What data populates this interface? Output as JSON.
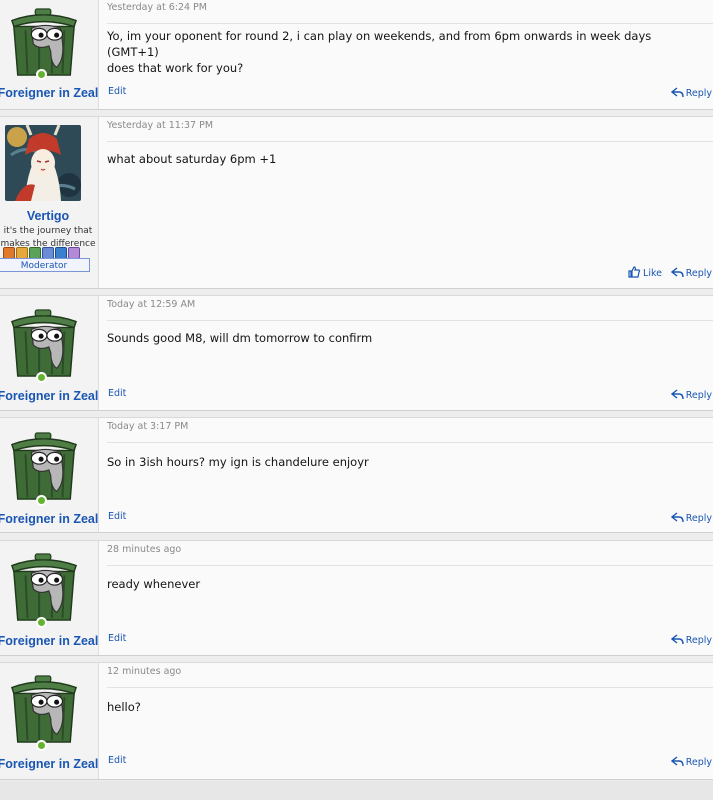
{
  "posts": [
    {
      "user": "Foreigner in Zeal",
      "timestamp": "Yesterday at 6:24 PM",
      "body_lines": [
        "Yo, im your oponent for round 2, i can play on weekends, and from 6pm onwards in week days (GMT+1)",
        "does that work for you?"
      ],
      "edit": "Edit",
      "reply": "Reply"
    },
    {
      "user": "Vertigo",
      "user_title_lines": [
        "it's the journey that",
        "makes the difference"
      ],
      "role": "Moderator",
      "timestamp": "Yesterday at 11:37 PM",
      "body_lines": [
        "what about saturday 6pm +1"
      ],
      "like": "Like",
      "reply": "Reply"
    },
    {
      "user": "Foreigner in Zeal",
      "timestamp": "Today at 12:59 AM",
      "body_lines": [
        "Sounds good M8, will dm tomorrow to confirm"
      ],
      "edit": "Edit",
      "reply": "Reply"
    },
    {
      "user": "Foreigner in Zeal",
      "timestamp": "Today at 3:17 PM",
      "body_lines": [
        "So in 3ish hours? my ign is chandelure enjoyr"
      ],
      "edit": "Edit",
      "reply": "Reply"
    },
    {
      "user": "Foreigner in Zeal",
      "timestamp": "28 minutes ago",
      "body_lines": [
        "ready whenever"
      ],
      "edit": "Edit",
      "reply": "Reply"
    },
    {
      "user": "Foreigner in Zeal",
      "timestamp": "12 minutes ago",
      "body_lines": [
        "hello?"
      ],
      "edit": "Edit",
      "reply": "Reply"
    }
  ],
  "icons": {
    "avatar": "trash-can-creature-icon",
    "online": "online-indicator-icon",
    "like": "thumbs-up-icon",
    "reply": "reply-arrow-icon",
    "badges": [
      "trophy-badge-icon",
      "trophy-badge-icon",
      "trophy-badge-icon",
      "trophy-badge-icon",
      "trophy-badge-icon",
      "trophy-badge-icon"
    ]
  },
  "colors": {
    "link": "#1a56b3",
    "online": "#63b32f",
    "avatar_green": "#3f6b36"
  }
}
